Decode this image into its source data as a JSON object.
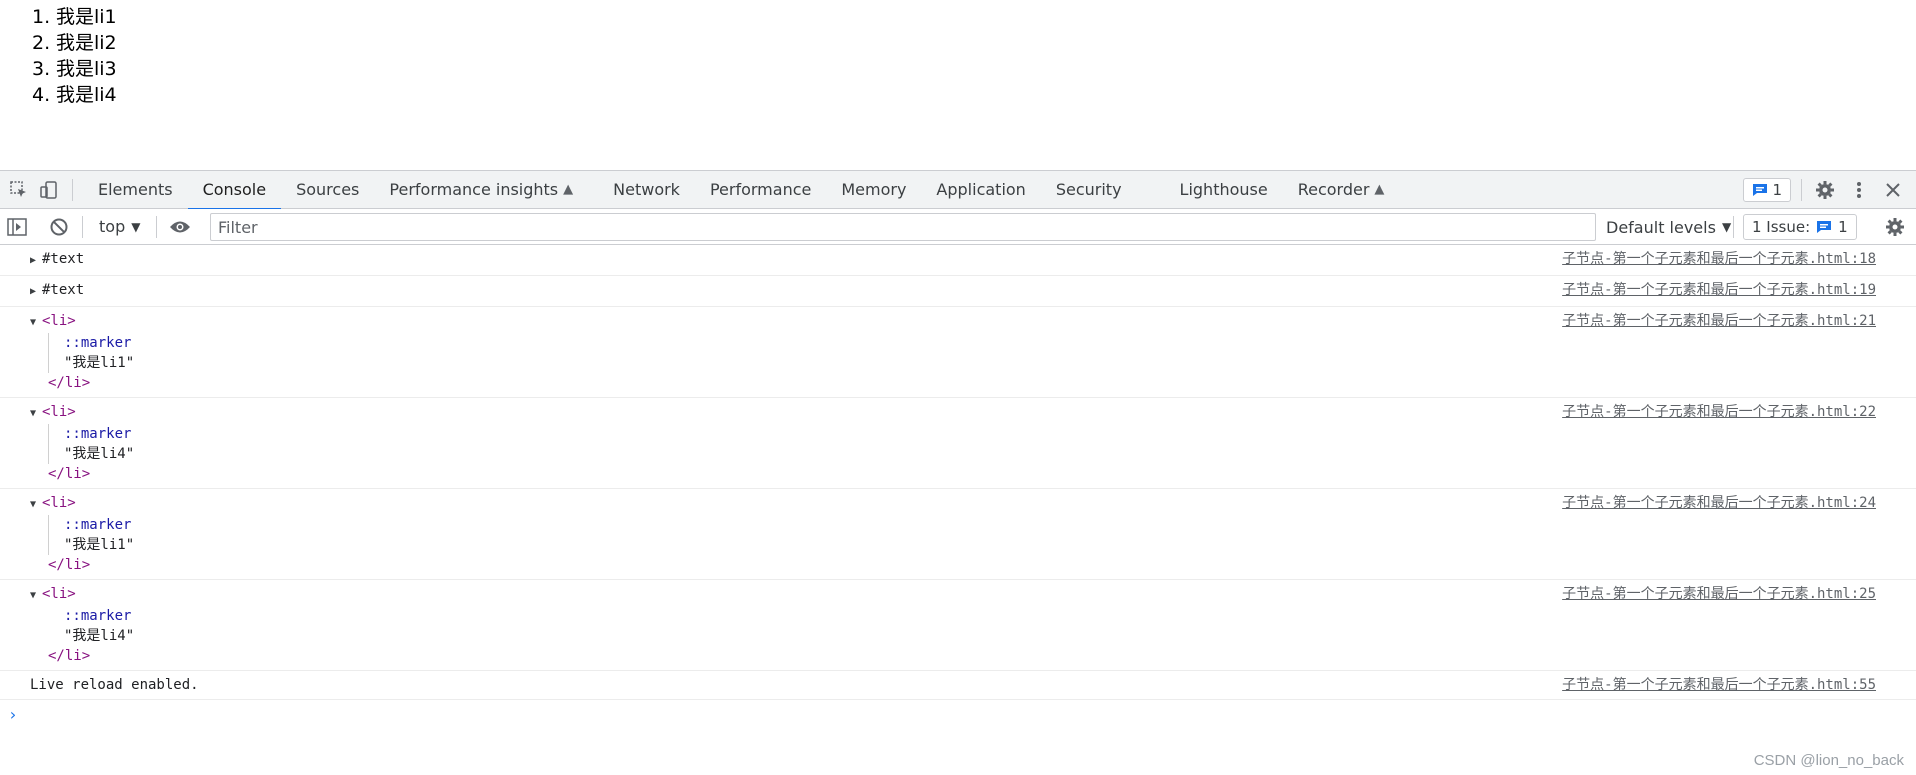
{
  "page": {
    "list_items": [
      {
        "num": "1.",
        "text": "我是li1"
      },
      {
        "num": "2.",
        "text": "我是li2"
      },
      {
        "num": "3.",
        "text": "我是li3"
      },
      {
        "num": "4.",
        "text": "我是li4"
      }
    ]
  },
  "devtools": {
    "tabs": [
      {
        "label": "Elements"
      },
      {
        "label": "Console",
        "active": true
      },
      {
        "label": "Sources"
      },
      {
        "label": "Performance insights",
        "experimental": true
      },
      {
        "label": "Network"
      },
      {
        "label": "Performance"
      },
      {
        "label": "Memory"
      },
      {
        "label": "Application"
      },
      {
        "label": "Security"
      },
      {
        "label": "Lighthouse"
      },
      {
        "label": "Recorder",
        "experimental": true
      }
    ],
    "message_count": "1",
    "icons": [
      "inspect-element-icon",
      "device-toolbar-icon",
      "settings-gear-icon",
      "more-options-icon",
      "close-icon"
    ]
  },
  "console_toolbar": {
    "context": "top",
    "filter_placeholder": "Filter",
    "levels_label": "Default levels",
    "issues_label": "1 Issue:",
    "issues_count": "1"
  },
  "messages": [
    {
      "kind": "text",
      "label": "#text",
      "source": "子节点-第一个子元素和最后一个子元素.html:18"
    },
    {
      "kind": "text",
      "label": "#text",
      "source": "子节点-第一个子元素和最后一个子元素.html:19"
    },
    {
      "kind": "li",
      "open": "<li>",
      "pseudo": "::marker",
      "str": "\"我是li1\"",
      "close": "</li>",
      "source": "子节点-第一个子元素和最后一个子元素.html:21"
    },
    {
      "kind": "li",
      "open": "<li>",
      "pseudo": "::marker",
      "str": "\"我是li4\"",
      "close": "</li>",
      "source": "子节点-第一个子元素和最后一个子元素.html:22"
    },
    {
      "kind": "li",
      "open": "<li>",
      "pseudo": "::marker",
      "str": "\"我是li1\"",
      "close": "</li>",
      "source": "子节点-第一个子元素和最后一个子元素.html:24"
    },
    {
      "kind": "li",
      "open": "<li>",
      "pseudo": "::marker",
      "str": "\"我是li4\"",
      "close": "</li>",
      "source": "子节点-第一个子元素和最后一个子元素.html:25"
    },
    {
      "kind": "log",
      "label": "Live reload enabled.",
      "source": "子节点-第一个子元素和最后一个子元素.html:55"
    }
  ],
  "prompt": "›",
  "watermark": "CSDN @lion_no_back",
  "colors": {
    "accent": "#1a73e8",
    "tag": "#881280",
    "pseudo": "#1a1aa6"
  }
}
